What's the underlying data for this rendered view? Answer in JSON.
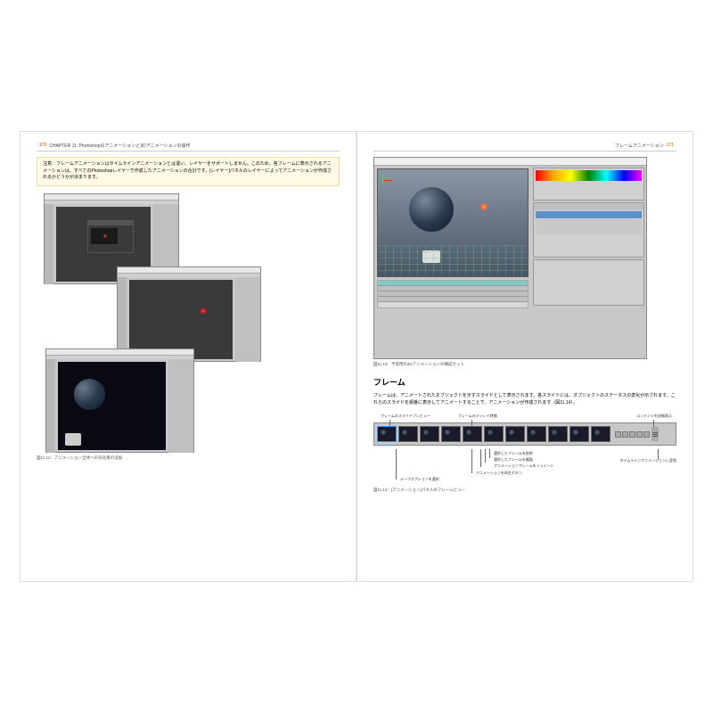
{
  "left": {
    "pageNum": "170",
    "header": "CHAPTER 11: Photoshopのアニメーションと3Dアニメーションの操作",
    "note": "注意：フレームアニメーションはタイムラインアニメーションとは違い、レイヤーをサポートしません。このため、各フレームに表示されるアニメーションは、すべてのPhotoshopレイヤーで作成したアニメーションの合計です。[レイヤー]パネルのレイヤーによってアニメーションが作成されるかどうかが決まります。",
    "caption": "図11.12：アニメーション全体への光効果の追加"
  },
  "right": {
    "pageNum": "171",
    "header": "フレームアニメーション",
    "caption1": "図11.13：予習用の3Dアニメーションの構成セット",
    "h2": "フレーム",
    "body": "フレームは、アニメートされたオブジェクトを示すスライドとして表示されます。各スライドには、オブジェクトのステータスの変化が示されます。これらのスライドを順番に表示してアニメートすることで、アニメーションが作成されます（図11.14）。",
    "labels": {
      "L1": "フレームのスライドプレビュー",
      "L2": "フレームのディレイ時間",
      "L3": "コンテンツを詳細表示"
    },
    "bottom": {
      "b1": "選択したフレームを削除",
      "b2": "選択したフレームを複製",
      "b3": "アニメーションフレームをトゥイーン",
      "b4": "アニメーションを再生ボタン",
      "b5": "ループオプションを選択",
      "b6": "タイムラインアニメーションに変換"
    },
    "caption2": "図11.14：[アニメーション]パネルのフレームビュー"
  }
}
